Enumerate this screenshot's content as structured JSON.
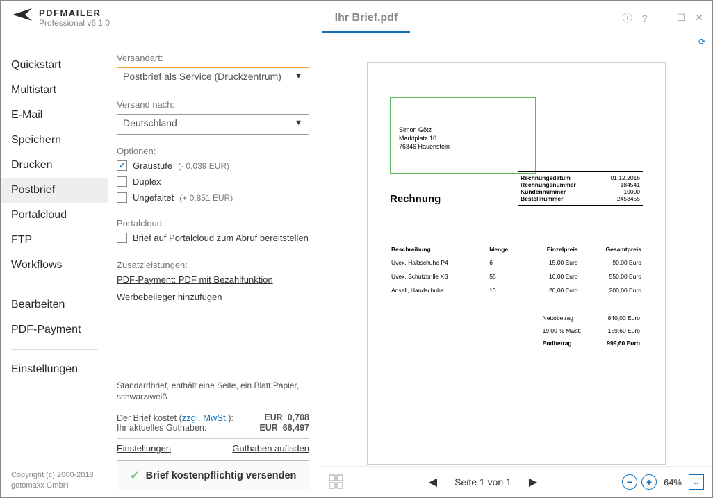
{
  "app": {
    "name": "PDFMAILER",
    "version": "Professional v6.1.0",
    "doc_title": "Ihr Brief.pdf"
  },
  "titlebar_icons": {
    "info": "ⓘ",
    "help": "?",
    "min": "—",
    "max": "☐",
    "close": "✕"
  },
  "sidebar": {
    "items": [
      {
        "label": "Quickstart"
      },
      {
        "label": "Multistart"
      },
      {
        "label": "E-Mail"
      },
      {
        "label": "Speichern"
      },
      {
        "label": "Drucken"
      },
      {
        "label": "Postbrief"
      },
      {
        "label": "Portalcloud"
      },
      {
        "label": "FTP"
      },
      {
        "label": "Workflows"
      }
    ],
    "items2": [
      {
        "label": "Bearbeiten"
      },
      {
        "label": "PDF-Payment"
      }
    ],
    "items3": [
      {
        "label": "Einstellungen"
      }
    ]
  },
  "copyright": {
    "line1": "Copyright (c) 2000-2018",
    "line2": "gotomaxx GmbH"
  },
  "panel": {
    "versandart_label": "Versandart:",
    "versandart_value": "Postbrief als Service (Druckzentrum)",
    "versandnach_label": "Versand nach:",
    "versandnach_value": "Deutschland",
    "optionen_label": "Optionen:",
    "opt_graustufe": "Graustufe",
    "opt_graustufe_price": "(- 0,039 EUR)",
    "opt_duplex": "Duplex",
    "opt_ungefaltet": "Ungefaltet",
    "opt_ungefaltet_price": "(+ 0,851 EUR)",
    "portalcloud_label": "Portalcloud:",
    "portalcloud_opt": "Brief auf Portalcloud zum Abruf bereitstellen",
    "zusatz_label": "Zusatzleistungen:",
    "link_pdfpay": "PDF-Payment: PDF mit Bezahlfunktion",
    "link_werbe": "Werbebeileger hinzufügen",
    "summary_text": "Standardbrief, enthält eine Seite, ein Blatt Papier, schwarz/weiß",
    "cost_label": "Der Brief kostet (",
    "cost_zzgl": "zzgl. MwSt.",
    "cost_close": "):",
    "cost_cur": "EUR",
    "cost_val": "0,708",
    "bal_label": "Ihr aktuelles Guthaben:",
    "bal_cur": "EUR",
    "bal_val": "68,497",
    "link_settings": "Einstellungen",
    "link_topup": "Guthaben aufladen",
    "send_btn": "Brief kostenpflichtig versenden"
  },
  "preview": {
    "refresh_icon": "⟳",
    "addr": {
      "name": "Simon Götz",
      "street": "Marktplatz 10",
      "city": "76846 Hauenstein"
    },
    "title": "Rechnung",
    "info": [
      {
        "k": "Rechnungsdatum",
        "v": "01.12.2016"
      },
      {
        "k": "Rechnungsnummer",
        "v": "184541"
      },
      {
        "k": "Kundennummer",
        "v": "10000"
      },
      {
        "k": "Bestellnummer",
        "v": "2453455"
      }
    ],
    "thead": {
      "desc": "Beschreibung",
      "qty": "Menge",
      "unit": "Einzelpreis",
      "total": "Gesamtpreis"
    },
    "rows": [
      {
        "desc": "Uvex, Halbschuhe P4",
        "qty": "6",
        "unit": "15,00 Euro",
        "total": "90,00 Euro"
      },
      {
        "desc": "Uvex, Schutzbrille XS",
        "qty": "55",
        "unit": "10,00 Euro",
        "total": "550,00 Euro"
      },
      {
        "desc": "Ansell, Handschuhe",
        "qty": "10",
        "unit": "20,00 Euro",
        "total": "200,00 Euro"
      }
    ],
    "totals": [
      {
        "k": "Nettobetrag",
        "v": "840,00 Euro"
      },
      {
        "k": "19,00 % Mwst.",
        "v": "159,60 Euro"
      },
      {
        "k": "Endbetrag",
        "v": "999,60 Euro",
        "bold": true
      }
    ],
    "pager": {
      "prev": "◀",
      "text": "Seite 1 von 1",
      "next": "▶"
    },
    "zoom": {
      "minus": "−",
      "plus": "+",
      "pct": "64%",
      "fit": "↔"
    }
  }
}
